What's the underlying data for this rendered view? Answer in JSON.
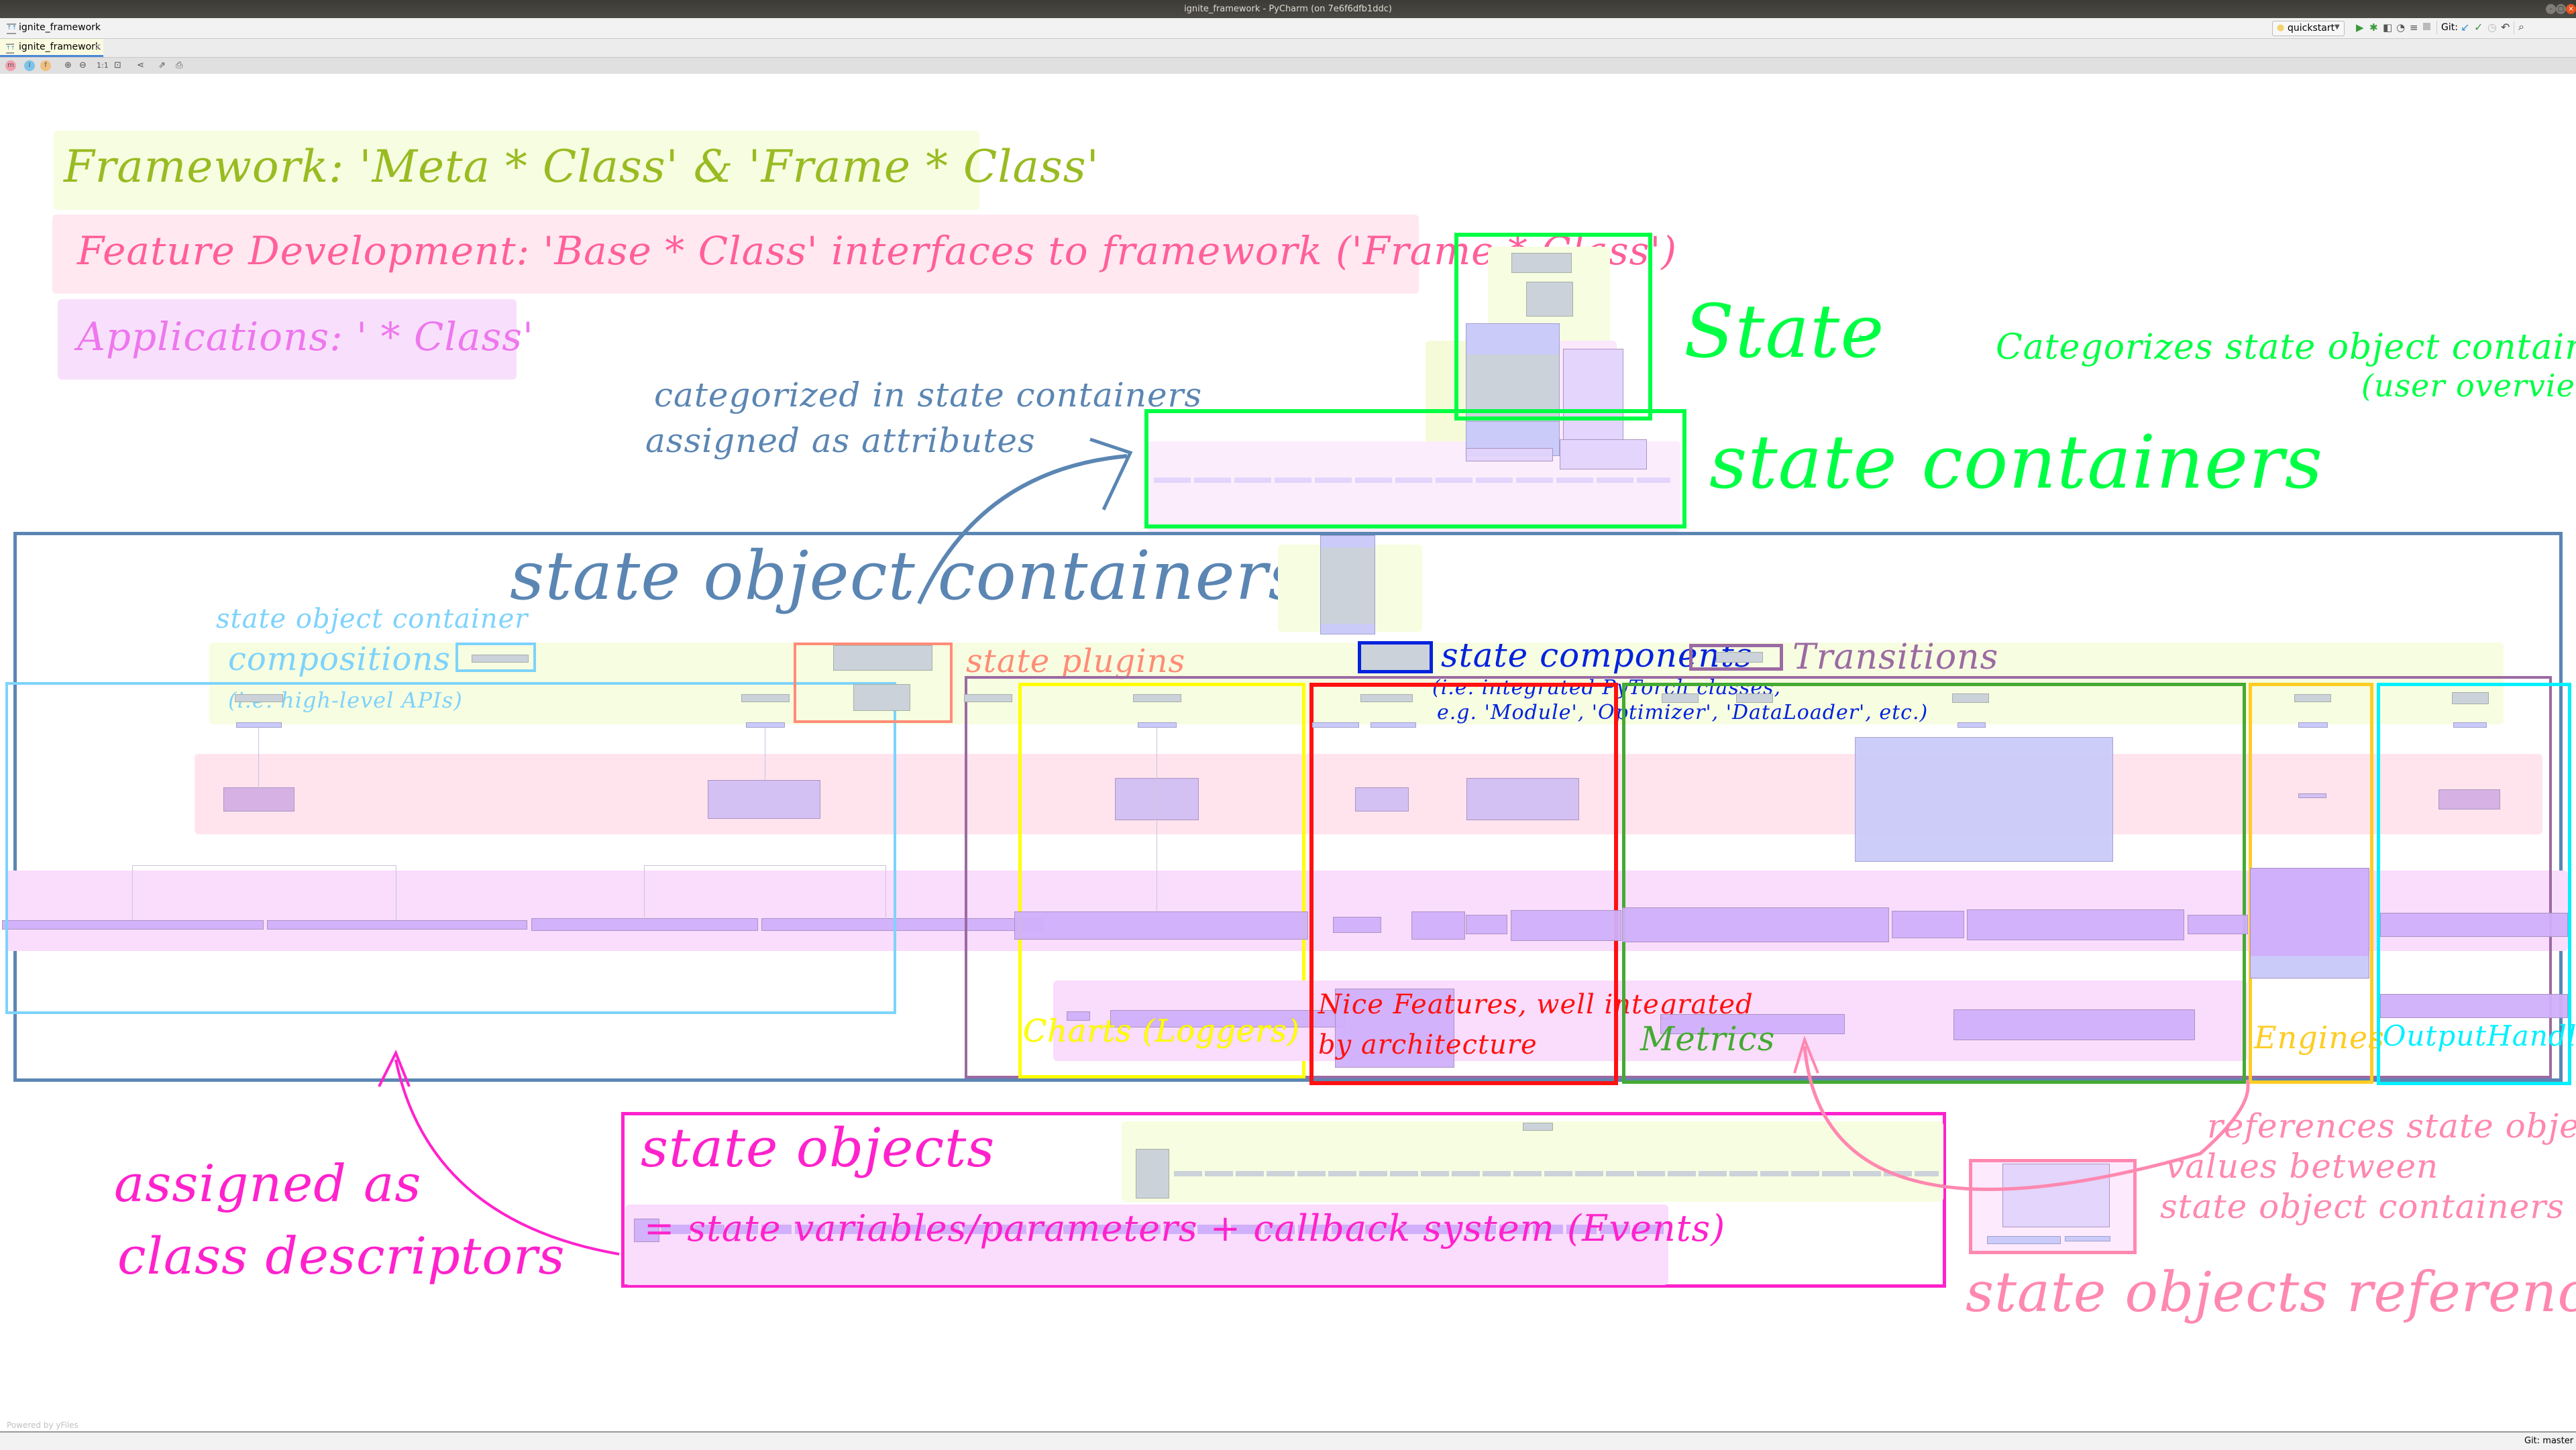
{
  "window": {
    "title": "ignite_framework - PyCharm (on 7e6f6dfb1ddc)",
    "controls": [
      "minimize",
      "maximize",
      "close"
    ]
  },
  "navbar": {
    "breadcrumb": "ignite_framework",
    "run_config": "quickstart",
    "git_label": "Git:"
  },
  "tabs": [
    {
      "label": "ignite_framework",
      "active": true,
      "close": "×"
    }
  ],
  "diagram_toolbar": {
    "filters": [
      {
        "label": "m",
        "name": "methods",
        "color": "#f0a0b0"
      },
      {
        "label": "I",
        "name": "inner-classes",
        "color": "#7cc4e8"
      },
      {
        "label": "f",
        "name": "fields",
        "color": "#f0c080"
      }
    ],
    "zoom_actual_label": "1:1"
  },
  "legend": {
    "framework": "Framework: 'Meta * Class' & 'Frame * Class'",
    "feature_dev": "Feature Development: 'Base * Class' interfaces to framework ('Frame * Class')",
    "applications": "Applications: ' * Class'"
  },
  "annotations": {
    "state": "State",
    "state_desc": "Categorizes state object containers",
    "state_desc2": "(user overview)",
    "state_containers": "state containers",
    "categorized": "categorized in state containers",
    "assigned_attrs": "assigned as attributes",
    "state_object_containers": "state object containers",
    "compositions_1": "state object container",
    "compositions_2": "compositions",
    "compositions_3": "(i.e. high-level APIs)",
    "state_plugins": "state plugins",
    "state_components": "state components",
    "state_components_desc1": "(i.e. integrated PyTorch classes,",
    "state_components_desc2": "e.g. 'Module', 'Optimizer', 'DataLoader', etc.)",
    "transitions": "Transitions",
    "charts": "Charts (Loggers)",
    "nice_features_1": "Nice Features, well integrated",
    "nice_features_2": "by architecture",
    "metrics": "Metrics",
    "engines": "Engines",
    "output_handlers": "OutputHandlers",
    "state_objects": "state objects",
    "state_objects_desc": "= state variables/parameters + callback system (Events)",
    "assigned_descriptors_1": "assigned as",
    "assigned_descriptors_2": "class descriptors",
    "references_1": "references state object",
    "references_2": "values between",
    "references_3": "state object containers",
    "state_objects_reference": "state objects reference"
  },
  "colors": {
    "framework": "#99bb22",
    "feature_dev": "#ff5f9a",
    "applications": "#ee77ee",
    "state_green": "#00ff44",
    "steel_blue": "#5b86b3",
    "light_blue": "#7dd3fc",
    "salmon": "#ff8c78",
    "purple": "#9b6aa3",
    "blue": "#0022dd",
    "yellow": "#ffff00",
    "red": "#ff1111",
    "green": "#44aa33",
    "orange": "#ffcc22",
    "cyan": "#00f0ff",
    "magenta": "#ff22cc",
    "pink": "#ff88b0"
  },
  "footer": {
    "watermark": "Powered by yFiles",
    "git_branch": "Git: master"
  }
}
